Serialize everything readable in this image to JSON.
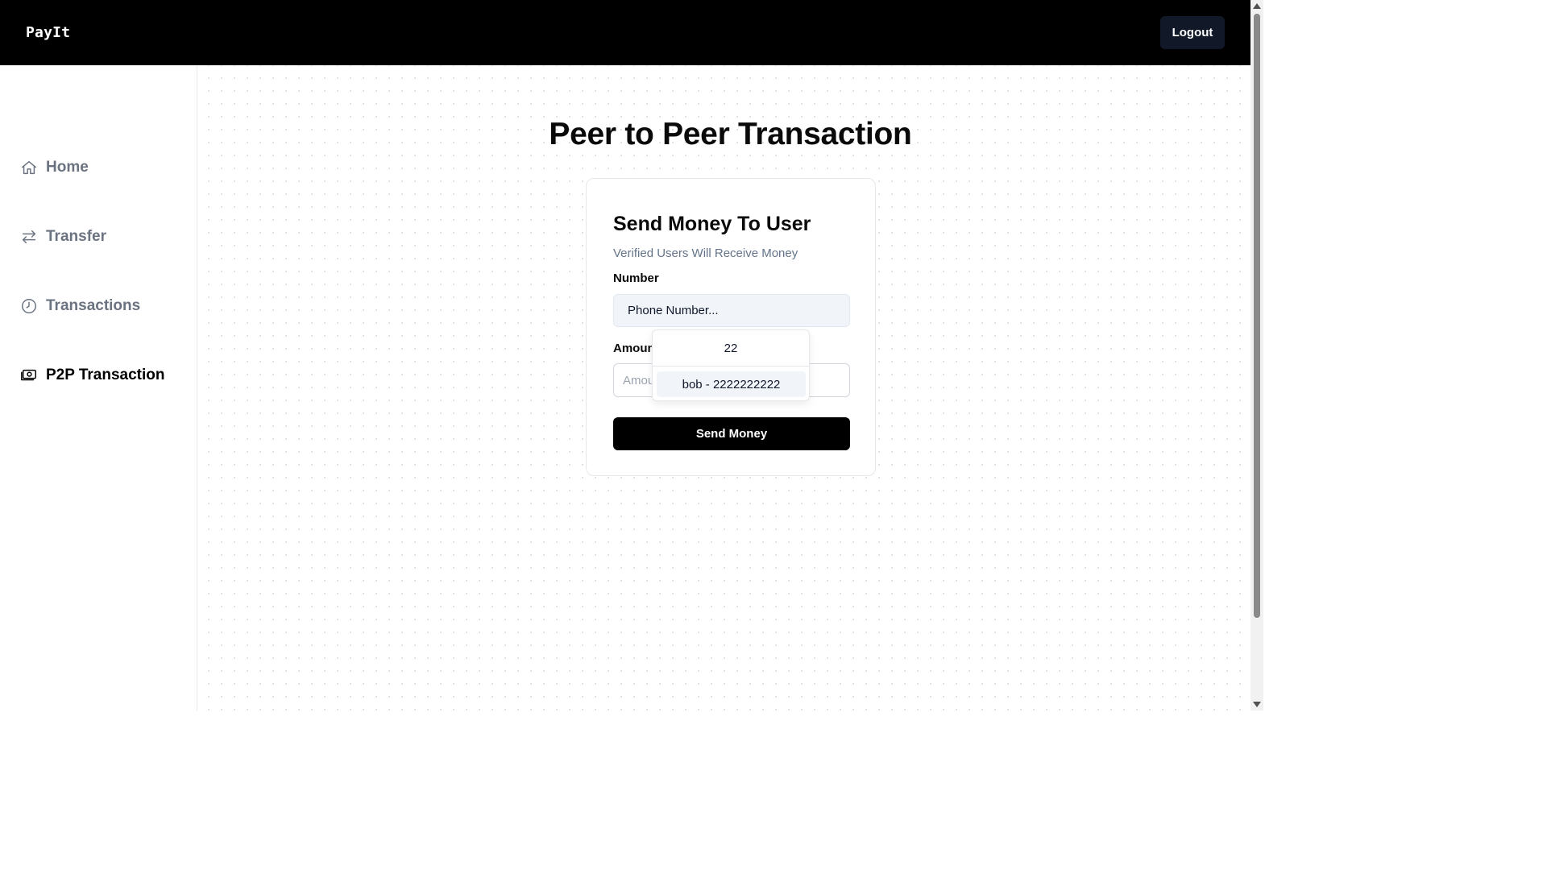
{
  "header": {
    "brand": "PayIt",
    "logout_label": "Logout"
  },
  "sidebar": {
    "items": [
      {
        "label": "Home",
        "icon": "home-icon",
        "active": false
      },
      {
        "label": "Transfer",
        "icon": "transfer-arrows-icon",
        "active": false
      },
      {
        "label": "Transactions",
        "icon": "clock-icon",
        "active": false
      },
      {
        "label": "P2P Transaction",
        "icon": "p2p-money-icon",
        "active": true
      }
    ]
  },
  "main": {
    "title": "Peer to Peer Transaction",
    "card": {
      "title": "Send Money To User",
      "subtitle": "Verified Users Will Receive Money",
      "number_label": "Number",
      "number_select_placeholder": "Phone Number...",
      "amount_label": "Amount",
      "amount_placeholder": "Amount",
      "send_button_label": "Send Money"
    },
    "dropdown": {
      "search_value": "22",
      "options": [
        {
          "label": "bob - 2222222222",
          "highlighted": true
        }
      ]
    }
  },
  "colors": {
    "topbar_bg": "#000000",
    "active_nav": "#000000",
    "inactive_nav": "#6b7280",
    "primary_button": "#000000",
    "select_bg": "#f1f5f9"
  }
}
